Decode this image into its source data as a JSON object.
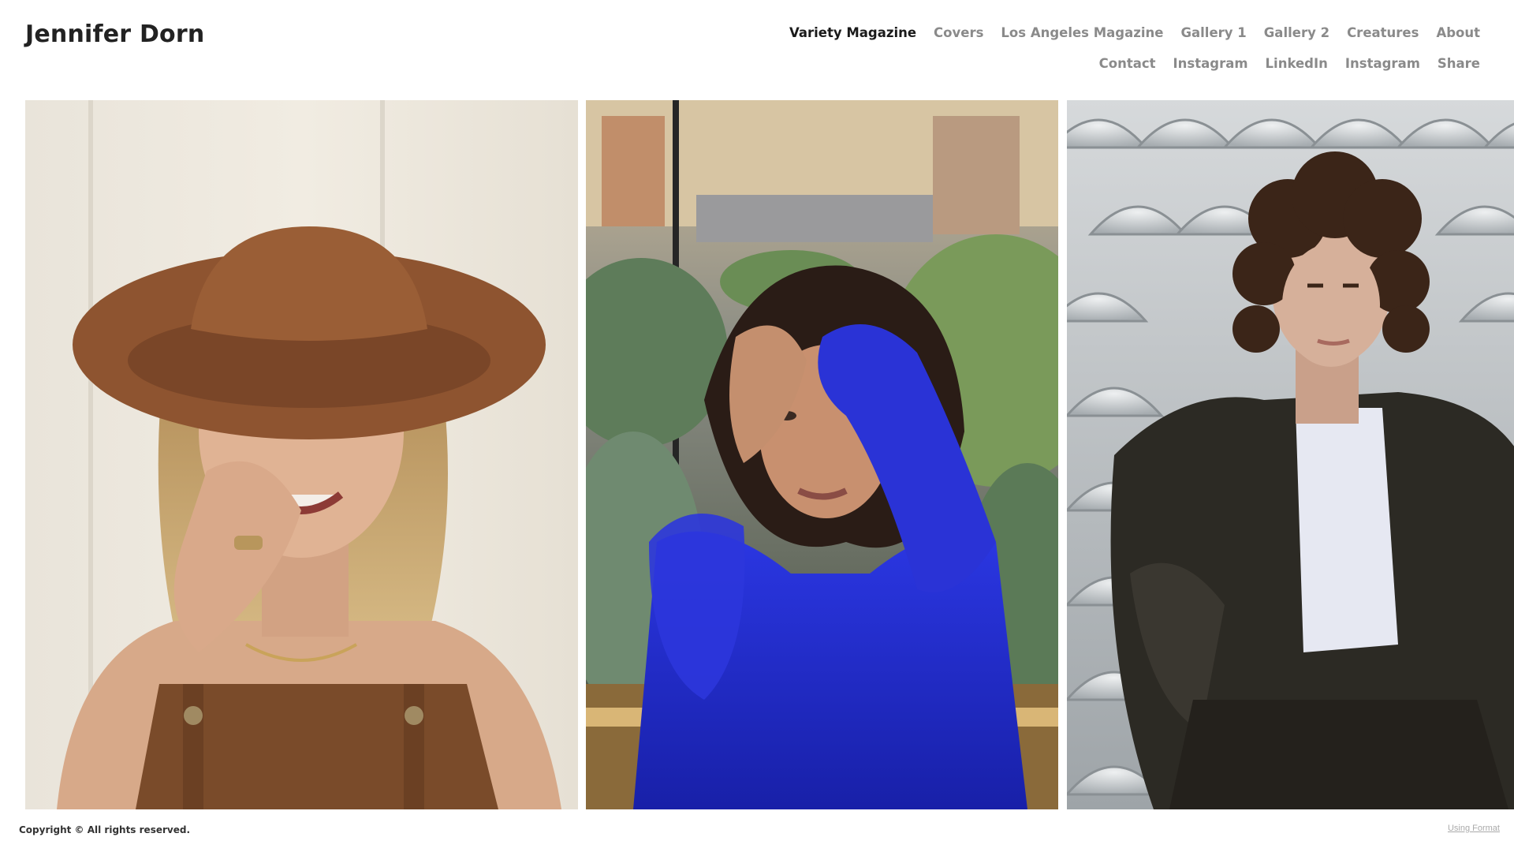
{
  "site": {
    "title": "Jennifer Dorn"
  },
  "nav": {
    "row1": [
      "Variety Magazine",
      "Covers",
      "Los Angeles Magazine",
      "Gallery 1",
      "Gallery 2",
      "Creatures",
      "About"
    ],
    "row2": [
      "Contact",
      "Instagram",
      "LinkedIn",
      "Instagram",
      "Share"
    ],
    "active": "Variety Magazine"
  },
  "colors": {
    "title": "#222222",
    "nav_inactive": "#8a8a8a",
    "nav_active": "#1a1a1a",
    "background": "#ffffff"
  },
  "gallery": {
    "photos": [
      {
        "id": "photo-1",
        "alt": ""
      },
      {
        "id": "photo-2",
        "alt": ""
      },
      {
        "id": "photo-3",
        "alt": ""
      }
    ]
  },
  "footer": {
    "copyright": "Copyright © All rights reserved.",
    "platform_link": "Using Format"
  }
}
